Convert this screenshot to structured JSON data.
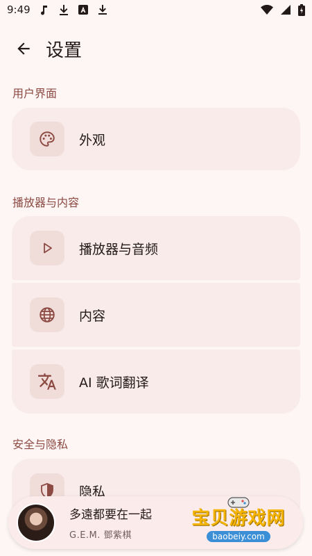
{
  "status_bar": {
    "time": "9:49"
  },
  "app_bar": {
    "title": "设置"
  },
  "sections": [
    {
      "label": "用户界面",
      "items": [
        {
          "label": "外观",
          "icon": "palette-icon"
        }
      ]
    },
    {
      "label": "播放器与内容",
      "items": [
        {
          "label": "播放器与音频",
          "icon": "play-icon"
        },
        {
          "label": "内容",
          "icon": "globe-icon"
        },
        {
          "label": "AI 歌词翻译",
          "icon": "translate-icon"
        }
      ]
    },
    {
      "label": "安全与隐私",
      "items": [
        {
          "label": "隐私",
          "icon": "shield-icon"
        }
      ]
    }
  ],
  "mini_player": {
    "title": "多遠都要在一起",
    "artist": "G.E.M. 鄧紫棋"
  },
  "watermark": {
    "text": "宝贝游戏网",
    "url": "baobeiy.com"
  },
  "colors": {
    "background": "#fdf6f5",
    "card": "#f8ebea",
    "icon_box": "#f0dcd9",
    "accent": "#8c4a43"
  }
}
